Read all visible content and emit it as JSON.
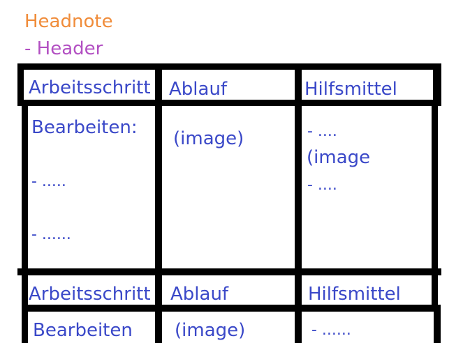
{
  "headnote": "Headnote",
  "header": "- Header",
  "table1": {
    "headers": [
      "Arbeitsschritt",
      "Ablauf",
      "Hilfsmittel"
    ],
    "row": {
      "col1": [
        "Bearbeiten:",
        "- .....",
        "- ......"
      ],
      "col2": "(image)",
      "col3": [
        "- ....",
        "(image",
        "- ...."
      ]
    }
  },
  "table2": {
    "headers": [
      "Arbeitsschritt",
      "Ablauf",
      "Hilfsmittel"
    ],
    "row": {
      "col1": "Bearbeiten",
      "col2": "(image)",
      "col3": "- ......"
    }
  },
  "colors": {
    "headnote": "#f08c3a",
    "header": "#b24fc2",
    "cell_text": "#3a48c8",
    "lines": "#000000"
  }
}
